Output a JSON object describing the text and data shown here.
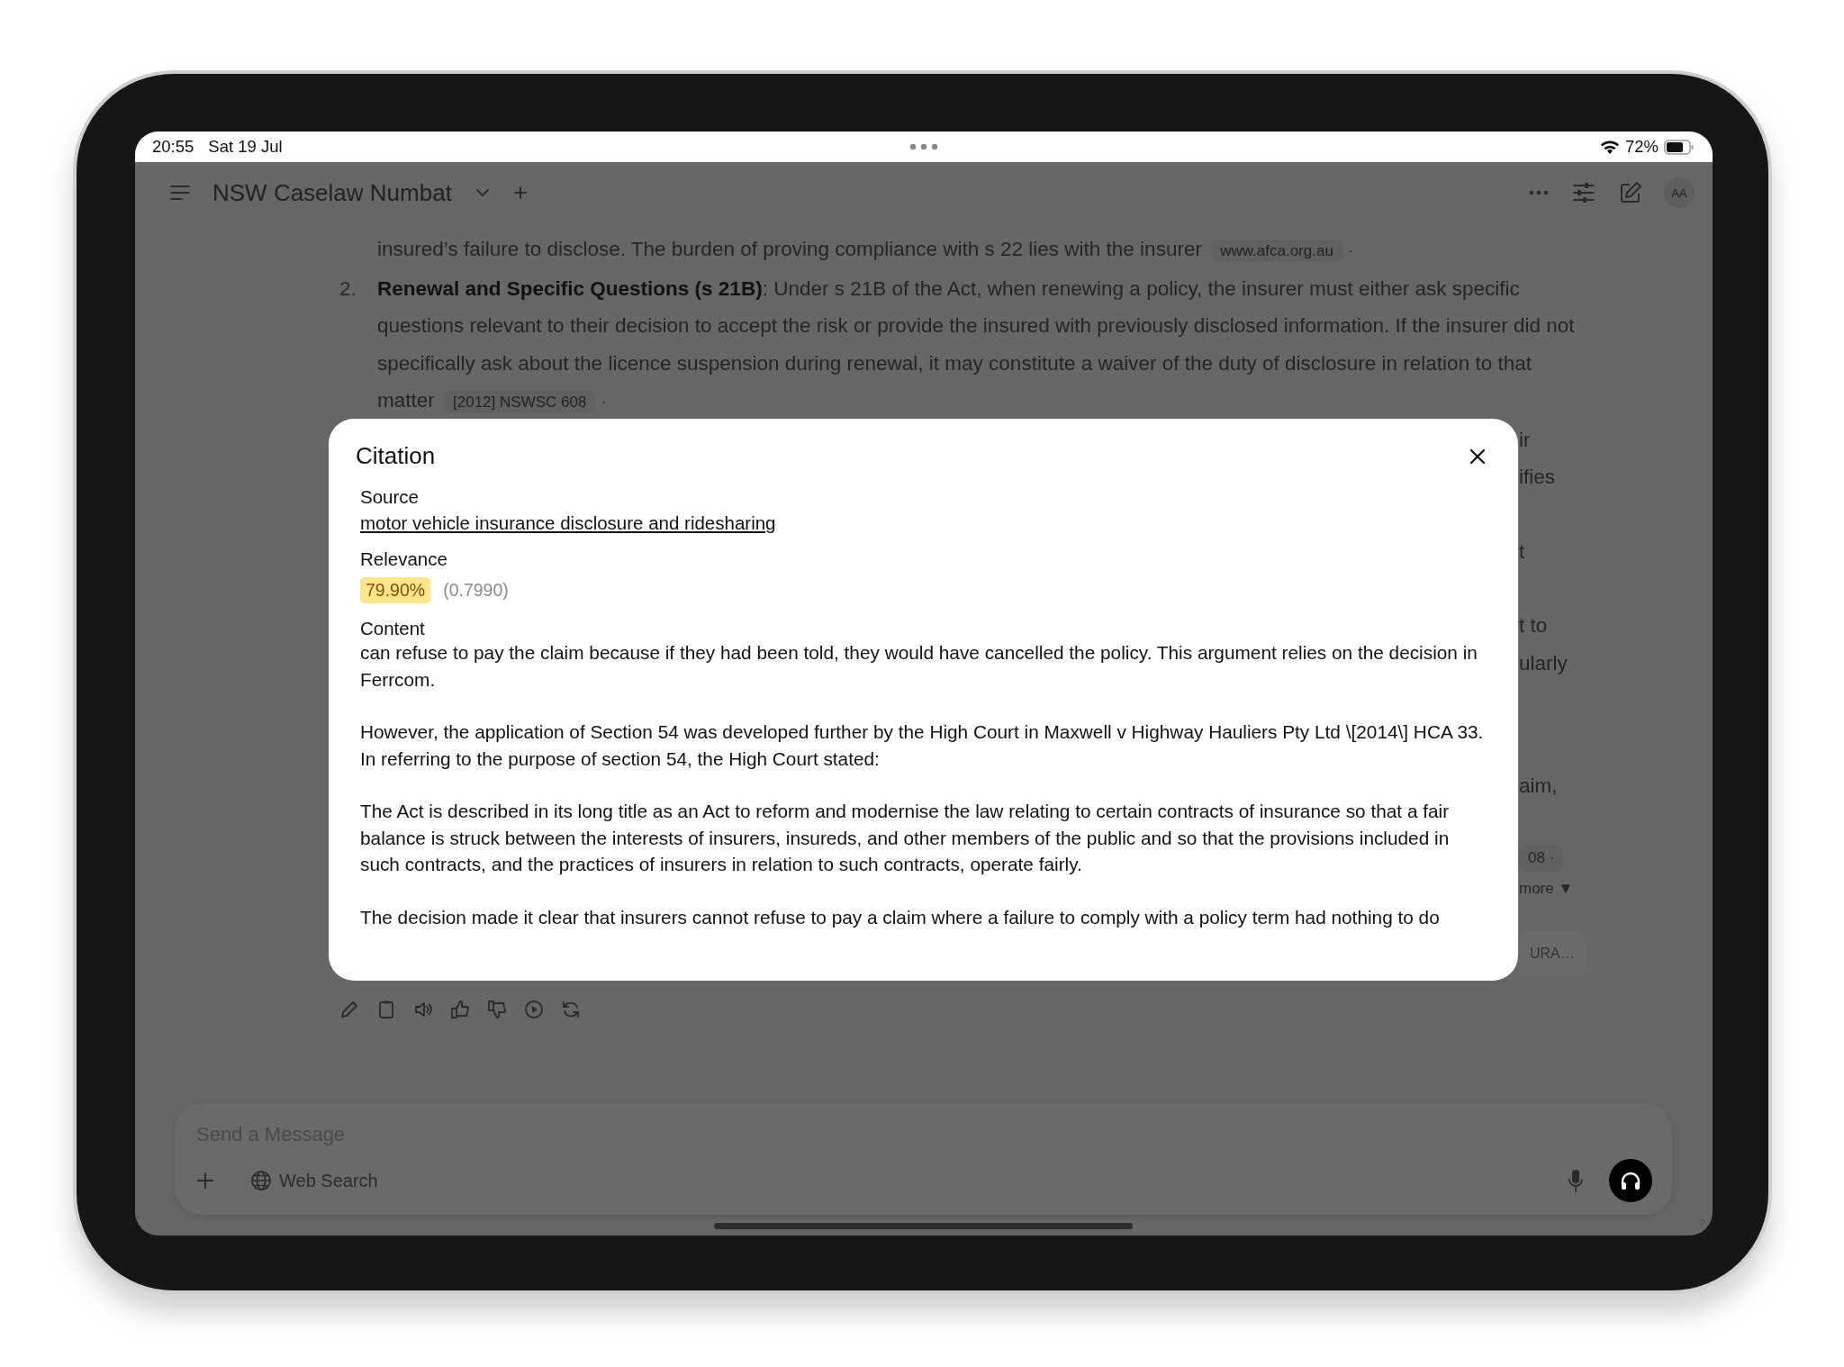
{
  "status_bar": {
    "time": "20:55",
    "date": "Sat 19 Jul",
    "battery": "72%"
  },
  "header": {
    "title": "NSW Caselaw Numbat",
    "avatar": "AA"
  },
  "conversation": {
    "items": [
      {
        "text": "insured’s failure to disclose. The burden of proving compliance with s 22 lies with the insurer",
        "source": "www.afca.org.au",
        "separator": "·"
      },
      {
        "number": "2.",
        "text": "**Renewal and Specific Questions (s 21B)**: Under s 21B of the Act, when renewing a policy, the insurer must either ask specific questions relevant to their decision to accept the risk or provide the insured with previously disclosed information. If the insurer did not specifically ask about the licence suspension during renewal, it may constitute a waiver of the duty of disclosure in relation to that matter",
        "source": "[2012] NSWSC 608",
        "separator": "·"
      }
    ],
    "fragments": [
      {
        "kind": "text",
        "text": "ir"
      },
      {
        "kind": "text",
        "text": "ifies"
      },
      {
        "kind": "text",
        "text": "t"
      },
      {
        "kind": "text",
        "text": "t to"
      },
      {
        "kind": "text",
        "text": "ularly"
      },
      {
        "kind": "text",
        "text": "aim,"
      },
      {
        "kind": "chip",
        "text": "08",
        "separator": "·"
      },
      {
        "kind": "more",
        "text": "more ▼"
      },
      {
        "kind": "card",
        "text": "URA…"
      }
    ]
  },
  "composer": {
    "placeholder": "Send a Message",
    "web_search": "Web Search",
    "help": "?"
  },
  "citation": {
    "title": "Citation",
    "source_label": "Source",
    "source": "motor vehicle insurance disclosure and ridesharing",
    "relevance_label": "Relevance",
    "relevance_percent": "79.90%",
    "relevance_score": "(0.7990)",
    "content_label": "Content",
    "paragraphs": [
      "can refuse to pay the claim because if they had been told, they would have cancelled the policy. This argument relies on the decision in Ferrcom.",
      "However, the application of Section 54 was developed further by the High Court in Maxwell v Highway Hauliers Pty Ltd \\[2014\\] HCA 33. In referring to the purpose of section 54, the High Court stated:",
      "The Act is described in its long title as an Act to reform and modernise the law relating to certain contracts of insurance so that a fair balance is struck between the interests of insurers, insureds, and other members of the public and so that the provisions included in such contracts, and the practices of insurers in relation to such contracts, operate fairly.",
      "The decision made it clear that insurers cannot refuse to pay a claim where a failure to comply with a policy term had nothing to do"
    ]
  }
}
